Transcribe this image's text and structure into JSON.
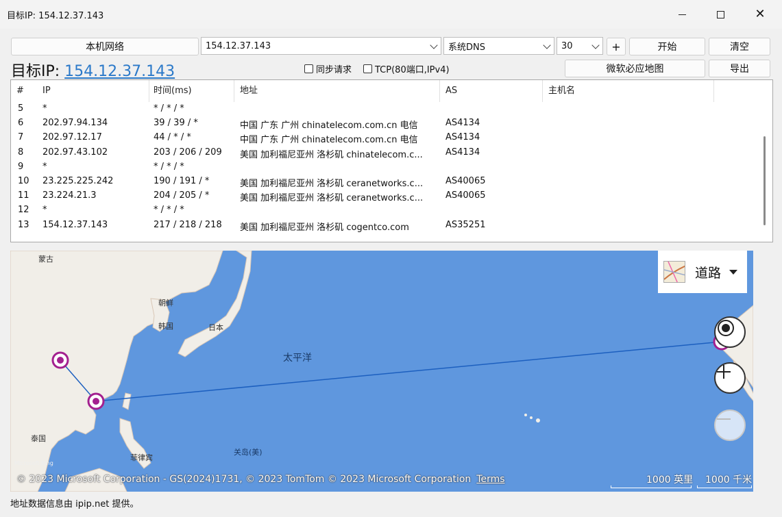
{
  "window": {
    "title": "目标IP: 154.12.37.143"
  },
  "toolbar": {
    "local_network_label": "本机网络",
    "ip_value": "154.12.37.143",
    "dns_value": "系统DNS",
    "count_value": "30",
    "plus_label": "+",
    "start_label": "开始",
    "clear_label": "清空",
    "bing_map_label": "微软必应地图",
    "export_label": "导出"
  },
  "target": {
    "prefix": "目标IP: ",
    "ip": "154.12.37.143"
  },
  "options": {
    "sync_label": "同步请求",
    "sync_checked": false,
    "tcp_label": "TCP(80端口,IPv4)",
    "tcp_checked": false
  },
  "table": {
    "headers": [
      "#",
      "IP",
      "时间(ms)",
      "地址",
      "AS",
      "主机名"
    ],
    "rows": [
      {
        "num": "5",
        "ip": "*",
        "time": "* / * / *",
        "addr": "",
        "as": ""
      },
      {
        "num": "6",
        "ip": "202.97.94.134",
        "time": "39 / 39 / *",
        "addr": "中国 广东 广州 chinatelecom.com.cn 电信",
        "as": "AS4134"
      },
      {
        "num": "7",
        "ip": "202.97.12.17",
        "time": "44 / * / *",
        "addr": "中国 广东 广州 chinatelecom.com.cn 电信",
        "as": "AS4134"
      },
      {
        "num": "8",
        "ip": "202.97.43.102",
        "time": "203 / 206 / 209",
        "addr": "美国 加利福尼亚州 洛杉矶 chinatelecom.c...",
        "as": "AS4134"
      },
      {
        "num": "9",
        "ip": "*",
        "time": "* / * / *",
        "addr": "",
        "as": ""
      },
      {
        "num": "10",
        "ip": "23.225.225.242",
        "time": "190 / 191 / *",
        "addr": "美国 加利福尼亚州 洛杉矶 ceranetworks.c...",
        "as": "AS40065"
      },
      {
        "num": "11",
        "ip": "23.224.21.3",
        "time": "204 / 205 / *",
        "addr": "美国 加利福尼亚州 洛杉矶 ceranetworks.c...",
        "as": "AS40065"
      },
      {
        "num": "12",
        "ip": "*",
        "time": "* / * / *",
        "addr": "",
        "as": ""
      },
      {
        "num": "13",
        "ip": "154.12.37.143",
        "time": "217 / 218 / 218",
        "addr": "美国 加利福尼亚州 洛杉矶 cogentco.com",
        "as": "AS35251"
      }
    ]
  },
  "map": {
    "layer_label": "道路",
    "labels": {
      "mongolia": "蒙古",
      "korea_n": "朝鲜",
      "korea_s": "韩国",
      "japan": "日本",
      "thailand": "泰国",
      "philippines": "菲律宾",
      "guam": "关岛(美)",
      "pacific": "太平洋"
    },
    "copyright": "© 2023 Microsoft Corporation - GS(2024)1731, © 2023 TomTom © 2023 Microsoft Corporation",
    "terms": "Terms",
    "scale_imperial": "1000 英里",
    "scale_metric": "1000 千米",
    "bing_logo": "Microsoft Bing",
    "colors": {
      "ocean": "#5f97de",
      "land": "#f1eee8",
      "route": "#1c5fbf",
      "pin": "#a3208f"
    }
  },
  "status": {
    "text": "地址数据信息由 ipip.net 提供。"
  }
}
